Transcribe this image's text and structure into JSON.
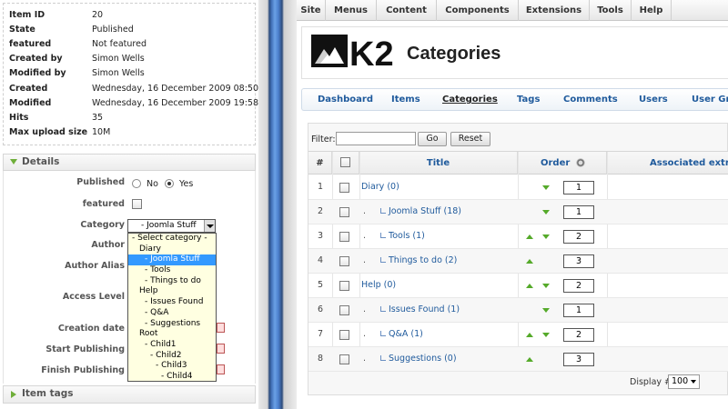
{
  "info": {
    "rows": [
      {
        "key": "Item ID",
        "value": "20"
      },
      {
        "key": "State",
        "value": "Published"
      },
      {
        "key": "featured",
        "value": "Not featured"
      },
      {
        "key": "Created by",
        "value": "Simon Wells"
      },
      {
        "key": "Modified by",
        "value": "Simon Wells"
      },
      {
        "key": "Created",
        "value": "Wednesday, 16 December 2009 08:50"
      },
      {
        "key": "Modified",
        "value": "Wednesday, 16 December 2009 19:58"
      },
      {
        "key": "Hits",
        "value": "35"
      },
      {
        "key": "Max upload size",
        "value": "10M"
      }
    ]
  },
  "details": {
    "heading": "Details",
    "published_label": "Published",
    "no_label": "No",
    "yes_label": "Yes",
    "published_value": "Yes",
    "featured_label": "featured",
    "category_label": "Category",
    "category_selected": "- Joomla Stuff",
    "category_options": [
      "- Select category -",
      "Diary",
      "- Joomla Stuff",
      "- Tools",
      "- Things to do",
      "Help",
      "- Issues Found",
      "- Q&A",
      "- Suggestions",
      "Root",
      "- Child1",
      "- Child2",
      "- Child3",
      "- Child4"
    ],
    "author_label": "Author",
    "author_alias_label": "Author Alias",
    "access_level_label": "Access Level",
    "creation_date_label": "Creation date",
    "start_publishing_label": "Start Publishing",
    "finish_publishing_label": "Finish Publishing"
  },
  "item_tags": {
    "heading": "Item tags"
  },
  "menu": [
    "Site",
    "Menus",
    "Content",
    "Components",
    "Extensions",
    "Tools",
    "Help"
  ],
  "header": {
    "logo_text": "K2",
    "title": "Categories"
  },
  "subnav": {
    "tabs": [
      "Dashboard",
      "Items",
      "Categories",
      "Tags",
      "Comments",
      "Users",
      "User Gro"
    ],
    "active": "Categories"
  },
  "filter": {
    "label": "Filter:",
    "value": "",
    "go_label": "Go",
    "reset_label": "Reset"
  },
  "table": {
    "headers": {
      "num": "#",
      "title": "Title",
      "order": "Order",
      "extra": "Associated extra f"
    },
    "rows": [
      {
        "num": "1",
        "prefix": "",
        "title": "Diary (0)",
        "order": "1",
        "up": false,
        "down": true
      },
      {
        "num": "2",
        "prefix": ".",
        "title": "Joomla Stuff (18)",
        "order": "1",
        "up": false,
        "down": true
      },
      {
        "num": "3",
        "prefix": ".",
        "title": "Tools (1)",
        "order": "2",
        "up": true,
        "down": true
      },
      {
        "num": "4",
        "prefix": ".",
        "title": "Things to do (2)",
        "order": "3",
        "up": true,
        "down": false
      },
      {
        "num": "5",
        "prefix": "",
        "title": "Help (0)",
        "order": "2",
        "up": true,
        "down": true
      },
      {
        "num": "6",
        "prefix": ".",
        "title": "Issues Found (1)",
        "order": "1",
        "up": false,
        "down": true
      },
      {
        "num": "7",
        "prefix": ".",
        "title": "Q&A (1)",
        "order": "2",
        "up": true,
        "down": true
      },
      {
        "num": "8",
        "prefix": ".",
        "title": "Suggestions (0)",
        "order": "3",
        "up": true,
        "down": false
      }
    ]
  },
  "footer": {
    "display_label": "Display #",
    "display_value": "100"
  },
  "colors": {
    "link": "#1f5a9c",
    "accent_green": "#55aa2a",
    "selected_option": "#3399ff"
  }
}
